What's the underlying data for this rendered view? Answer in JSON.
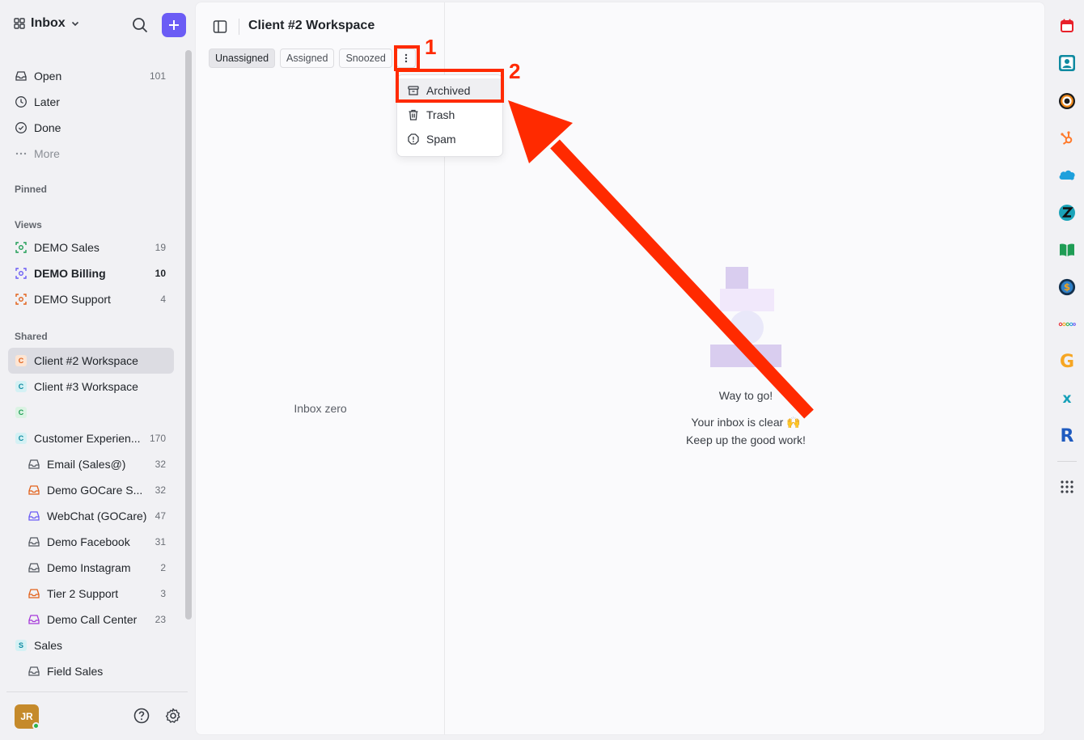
{
  "sidebar": {
    "switcher_label": "Inbox",
    "nav": [
      {
        "label": "Open",
        "count": "101"
      },
      {
        "label": "Later",
        "count": ""
      },
      {
        "label": "Done",
        "count": ""
      },
      {
        "label": "More",
        "count": ""
      }
    ],
    "sections": {
      "pinned": "Pinned",
      "views": "Views",
      "shared": "Shared"
    },
    "views": [
      {
        "label": "DEMO Sales",
        "count": "19",
        "color": "#1f9d55"
      },
      {
        "label": "DEMO Billing",
        "count": "10",
        "color": "#6b5cf5"
      },
      {
        "label": "DEMO Support",
        "count": "4",
        "color": "#e2621b"
      }
    ],
    "shared": [
      {
        "badge": "C",
        "label": "Client #2 Workspace",
        "count": ""
      },
      {
        "badge": "C",
        "label": "Client #3 Workspace",
        "count": ""
      },
      {
        "badge": "C",
        "label": "",
        "count": ""
      },
      {
        "badge": "C",
        "label": "Customer Experien...",
        "count": "170"
      },
      {
        "label": "Email (Sales@)",
        "count": "32",
        "color": "#555a62"
      },
      {
        "label": "Demo GOCare S...",
        "count": "32",
        "color": "#e2621b"
      },
      {
        "label": "WebChat (GOCare)",
        "count": "47",
        "color": "#6b5cf5"
      },
      {
        "label": "Demo Facebook",
        "count": "31",
        "color": "#555a62"
      },
      {
        "label": "Demo Instagram",
        "count": "2",
        "color": "#555a62"
      },
      {
        "label": "Tier 2 Support",
        "count": "3",
        "color": "#e2621b"
      },
      {
        "label": "Demo Call Center",
        "count": "23",
        "color": "#a63ad9"
      },
      {
        "badge": "S",
        "label": "Sales",
        "count": ""
      },
      {
        "label": "Field Sales",
        "count": "",
        "color": "#555a62"
      }
    ],
    "user_initials": "JR"
  },
  "workspace": {
    "title": "Client #2 Workspace",
    "tabs": [
      "Unassigned",
      "Assigned",
      "Snoozed"
    ],
    "empty_list": "Inbox zero"
  },
  "menu": {
    "items": [
      "Archived",
      "Trash",
      "Spam"
    ]
  },
  "annotations": {
    "n1": "1",
    "n2": "2",
    "color": "#ff2a00"
  },
  "empty_state": {
    "title": "Way to go!",
    "line1": "Your inbox is clear 🙌",
    "line2": "Keep up the good work!"
  },
  "rail_icons": [
    "calendar-icon",
    "contact-card-icon",
    "target-icon",
    "hubspot-icon",
    "salesforce-icon",
    "zendesk-icon",
    "book-icon",
    "dollar-icon",
    "dots-logo-icon",
    "g-logo-icon",
    "x-logo-icon",
    "r-logo-icon",
    "apps-grid-icon"
  ],
  "accent": "#6b5cf5"
}
